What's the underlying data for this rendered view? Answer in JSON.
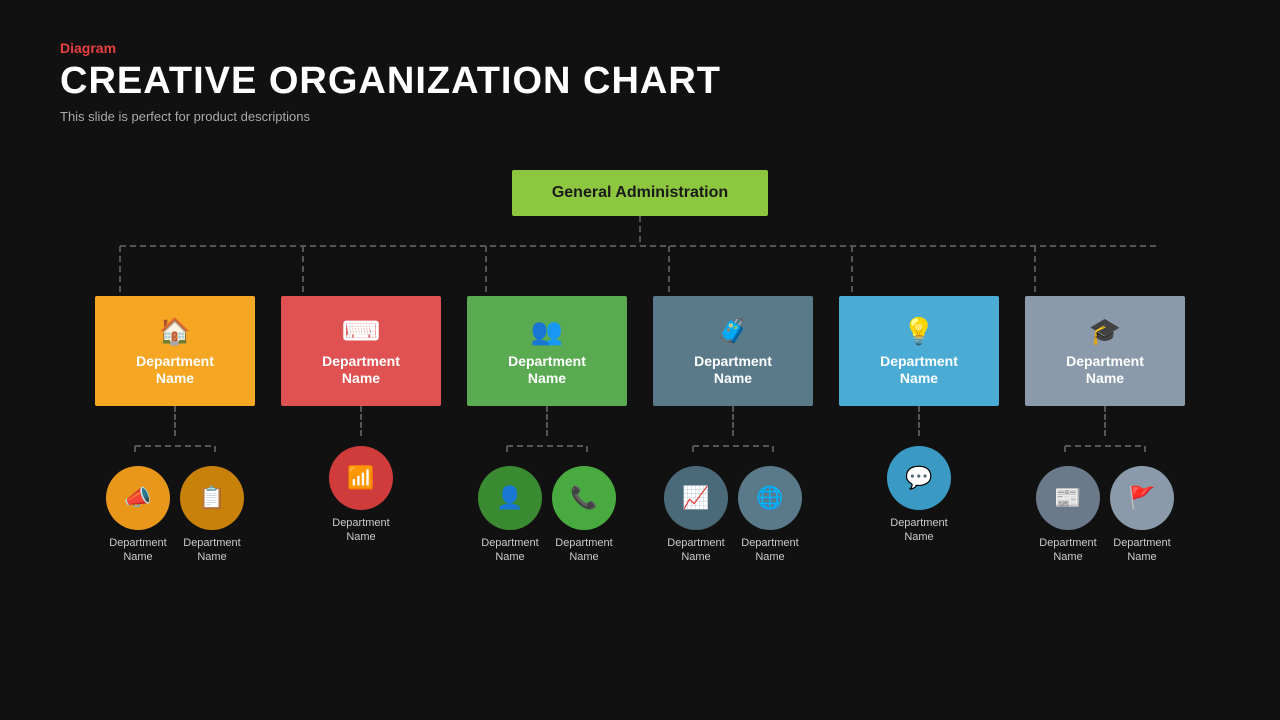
{
  "header": {
    "diagram_label": "Diagram",
    "title": "CREATIVE ORGANIZATION CHART",
    "subtitle": "This slide is perfect for product descriptions"
  },
  "top_node": {
    "label": "General Administration",
    "color": "#8dc63f"
  },
  "departments": [
    {
      "id": "dept-1",
      "color": "orange",
      "icon": "🏠",
      "label": "Department\nName",
      "sub_items": [
        {
          "icon": "📣",
          "color": "orange-circle",
          "label": "Department\nName"
        },
        {
          "icon": "📋",
          "color": "orange-circle2",
          "label": "Department\nName"
        }
      ]
    },
    {
      "id": "dept-2",
      "color": "red",
      "icon": "⌨",
      "label": "Department\nName",
      "sub_items": [
        {
          "icon": "📶",
          "color": "red-circle",
          "label": "Department\nName"
        }
      ]
    },
    {
      "id": "dept-3",
      "color": "green",
      "icon": "👥",
      "label": "Department\nName",
      "sub_items": [
        {
          "icon": "👤",
          "color": "green-circle",
          "label": "Department\nName"
        },
        {
          "icon": "📞",
          "color": "green-circle2",
          "label": "Department\nName"
        }
      ]
    },
    {
      "id": "dept-4",
      "color": "teal",
      "icon": "🧳",
      "label": "Department\nName",
      "sub_items": [
        {
          "icon": "📈",
          "color": "teal-circle",
          "label": "Department\nName"
        },
        {
          "icon": "🌐",
          "color": "teal-circle2",
          "label": "Department\nName"
        }
      ]
    },
    {
      "id": "dept-5",
      "color": "blue",
      "icon": "💡",
      "label": "Department\nName",
      "sub_items": [
        {
          "icon": "💬",
          "color": "blue-circle",
          "label": "Department\nName"
        }
      ]
    },
    {
      "id": "dept-6",
      "color": "gray",
      "icon": "🎓",
      "label": "Department\nName",
      "sub_items": [
        {
          "icon": "📰",
          "color": "gray-circle",
          "label": "Department\nName"
        },
        {
          "icon": "🚩",
          "color": "gray-circle2",
          "label": "Department\nName"
        }
      ]
    }
  ],
  "colors": {
    "orange": "#f5a623",
    "red": "#e05252",
    "green": "#5aaa52",
    "teal": "#5a7a8a",
    "blue": "#4aacd4",
    "gray": "#8a9aaa",
    "orange_circle": "#e8971a",
    "orange_circle2": "#c8820a",
    "red_circle": "#d03c3c",
    "green_circle": "#3a8a32",
    "green_circle2": "#4aaa42",
    "teal_circle": "#4a6a7a",
    "teal_circle2": "#5a7a8a",
    "blue_circle": "#3a9ac4",
    "gray_circle": "#6a7a8a",
    "gray_circle2": "#8a9aaa"
  }
}
